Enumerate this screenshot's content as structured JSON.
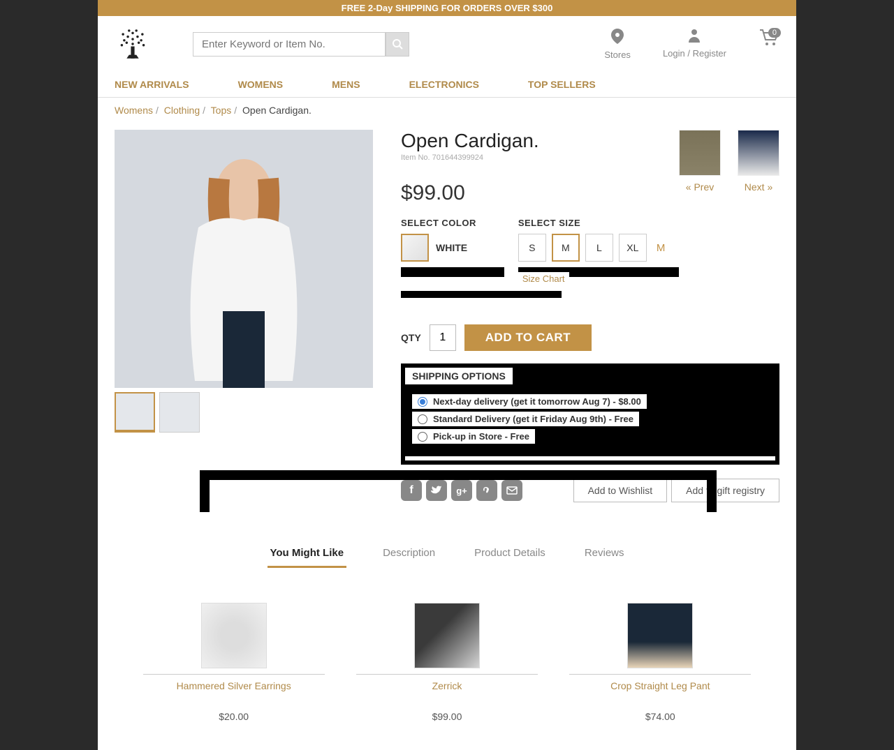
{
  "promo": "FREE 2-Day SHIPPING FOR ORDERS OVER $300",
  "search": {
    "placeholder": "Enter Keyword or Item No."
  },
  "header": {
    "stores": "Stores",
    "login": "Login / Register",
    "cart_count": "0"
  },
  "nav": [
    "NEW ARRIVALS",
    "WOMENS",
    "MENS",
    "ELECTRONICS",
    "TOP SELLERS"
  ],
  "breadcrumb": {
    "items": [
      "Womens",
      "Clothing",
      "Tops"
    ],
    "current": "Open Cardigan."
  },
  "product": {
    "title": "Open Cardigan.",
    "item_no": "Item No. 701644399924",
    "price": "$99.00",
    "color_label": "SELECT COLOR",
    "color_name": "WHITE",
    "size_label": "SELECT SIZE",
    "sizes": [
      "S",
      "M",
      "L",
      "XL"
    ],
    "size_selected": "M",
    "size_chart": "Size Chart",
    "qty_label": "QTY",
    "qty_value": "1",
    "add_to_cart": "ADD TO CART"
  },
  "shipping": {
    "header": "SHIPPING OPTIONS",
    "options": [
      "Next-day delivery (get it tomorrow Aug 7) - $8.00",
      "Standard Delivery (get it Friday Aug 9th) - Free",
      "Pick-up in Store - Free"
    ]
  },
  "share": {
    "wishlist": "Add to Wishlist",
    "gift": "Add to gift registry"
  },
  "prevnext": {
    "prev": "« Prev",
    "next": "Next »"
  },
  "tabs": [
    "You Might Like",
    "Description",
    "Product Details",
    "Reviews"
  ],
  "recs": [
    {
      "name": "Hammered Silver Earrings",
      "price": "$20.00"
    },
    {
      "name": "Zerrick",
      "price": "$99.00"
    },
    {
      "name": "Crop Straight Leg Pant",
      "price": "$74.00"
    }
  ]
}
